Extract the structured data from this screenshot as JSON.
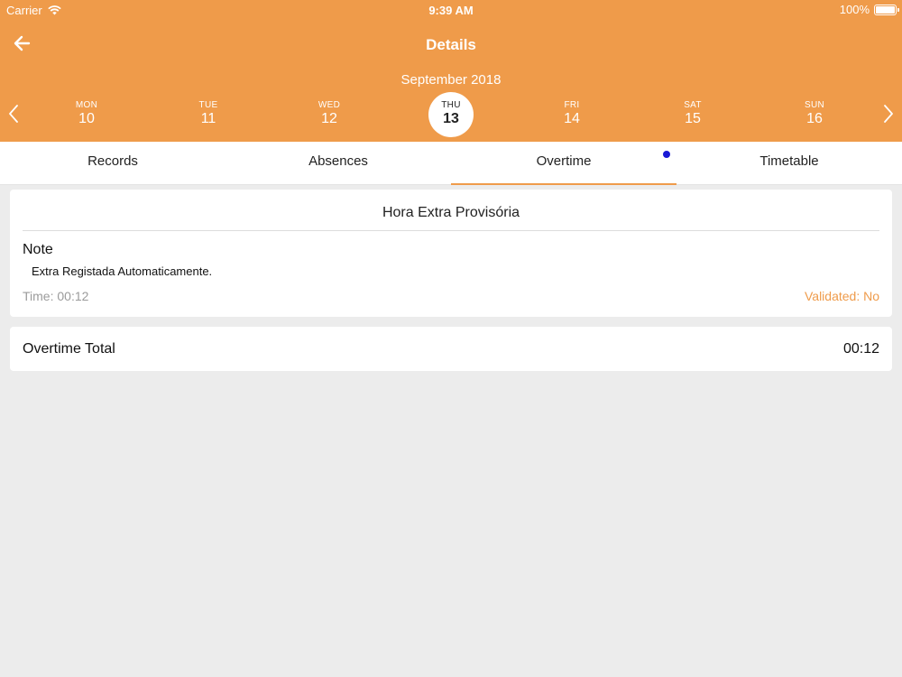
{
  "status_bar": {
    "carrier": "Carrier",
    "time": "9:39 AM",
    "battery": "100%",
    "wifi_icon": "wifi-icon",
    "battery_icon": "battery-icon"
  },
  "header": {
    "title": "Details",
    "back_icon": "arrow-left-icon",
    "month": "September 2018",
    "prev_icon": "chevron-left-icon",
    "next_icon": "chevron-right-icon",
    "days": [
      {
        "name": "MON",
        "num": "10"
      },
      {
        "name": "TUE",
        "num": "11"
      },
      {
        "name": "WED",
        "num": "12"
      },
      {
        "name": "THU",
        "num": "13",
        "selected": true
      },
      {
        "name": "FRI",
        "num": "14"
      },
      {
        "name": "SAT",
        "num": "15"
      },
      {
        "name": "SUN",
        "num": "16"
      }
    ]
  },
  "tabs": [
    {
      "label": "Records"
    },
    {
      "label": "Absences"
    },
    {
      "label": "Overtime",
      "active": true
    },
    {
      "label": "Timetable"
    }
  ],
  "overtime_card": {
    "title": "Hora Extra Provisória",
    "note_label": "Note",
    "note_text": "Extra Registada Automaticamente.",
    "time": "Time: 00:12",
    "validated": "Validated: No"
  },
  "total_card": {
    "label": "Overtime Total",
    "value": "00:12"
  },
  "colors": {
    "accent": "#ef9b4a",
    "background": "#ececec",
    "indicator_dot": "#1a1ad6"
  }
}
